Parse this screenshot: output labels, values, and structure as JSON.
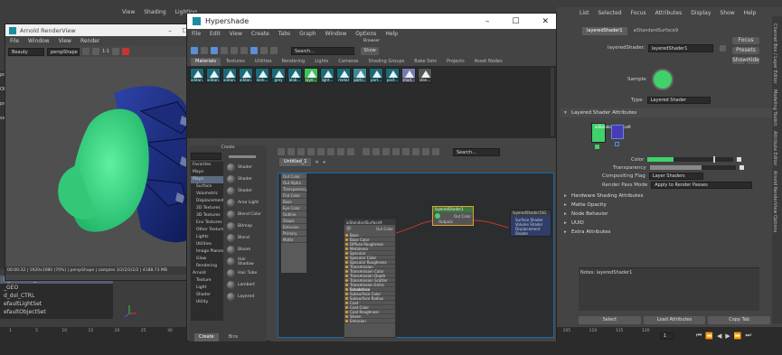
{
  "maya_main": {
    "menu_right": [
      "List",
      "Selected",
      "Focus",
      "Attributes",
      "Display",
      "Show",
      "Help"
    ],
    "left_labels": [
      "port",
      "Obj",
      "ps",
      "ss",
      "ssL",
      "sSL",
      "0",
      "GEO"
    ],
    "outliner_items": [
      "R_shoulder_GEO",
      "_GEO",
      "d_dol_CTRL",
      "efaultLightSet",
      "efaultObjectSet"
    ],
    "timeline_ticks": [
      "1",
      "5",
      "10",
      "15",
      "20",
      "25",
      "30",
      "35",
      "40",
      "45",
      "50",
      "55",
      "60",
      "65",
      "70",
      "75",
      "80",
      "85",
      "90",
      "95",
      "100",
      "105",
      "110",
      "115",
      "120"
    ],
    "frame_field": "1",
    "top_menu": [
      "View",
      "Shading",
      "Lighting"
    ]
  },
  "renderview": {
    "title": "Arnold RenderView",
    "menu": [
      "File",
      "Window",
      "View",
      "Render"
    ],
    "camera_preset": "Beauty",
    "camera": "perspShape",
    "ratio": "1:1",
    "status": "00:00:32 | 1920x1080 (70%) | perspShape | samples 3/2/2/2/2/2 | 4188.73 MB"
  },
  "hypershade": {
    "title": "Hypershade",
    "menu": [
      "File",
      "Edit",
      "View",
      "Create",
      "Tabs",
      "Graph",
      "Window",
      "Options",
      "Help"
    ],
    "browser_label": "Browser",
    "search_placeholder": "Search...",
    "show_label": "Show",
    "browser_tabs": [
      "Materials",
      "Textures",
      "Utilities",
      "Rendering",
      "Lights",
      "Cameras",
      "Shading Groups",
      "Bake Sets",
      "Projects",
      "Asset Nodes"
    ],
    "materials": [
      {
        "name": "aiStan...",
        "color": "#1a6b7a"
      },
      {
        "name": "aiStan...",
        "color": "#1a6b7a"
      },
      {
        "name": "aiStan...",
        "color": "#1a6b7a"
      },
      {
        "name": "aiStan...",
        "color": "#1a6b7a"
      },
      {
        "name": "dark...",
        "color": "#1a6b7a"
      },
      {
        "name": "grey",
        "color": "#1a6b7a"
      },
      {
        "name": "blob...",
        "color": "#1a6b7a"
      },
      {
        "name": "laye...",
        "color": "#3fc45a"
      },
      {
        "name": "light...",
        "color": "#1a6b7a"
      },
      {
        "name": "metal",
        "color": "#1a6b7a"
      },
      {
        "name": "parti...",
        "color": "#3a8a9a"
      },
      {
        "name": "part...",
        "color": "#1a6b7a"
      },
      {
        "name": "past...",
        "color": "#1a6b7a"
      },
      {
        "name": "shad...",
        "color": "#7a7ab0"
      },
      {
        "name": "stan...",
        "color": "#555555"
      }
    ],
    "create_label": "Create",
    "create_tree": [
      "Favorites",
      "Maya",
      "Maya",
      "Surface",
      "Volumetric",
      "Displacement",
      "2D Textures",
      "3D Textures",
      "Env Textures",
      "Other Textures",
      "Lights",
      "Utilities",
      "Image Planes",
      "Glow",
      "Rendering",
      "Arnold",
      "Texture",
      "Light",
      "Shader",
      "Utility"
    ],
    "create_nodes": [
      "Shader",
      "Shader",
      "Shader",
      "Area Light",
      "Blend Color",
      "Bitmap",
      "Blend",
      "Bloom",
      "Hair Shadow",
      "Hair Tube",
      "Lambert",
      "Layered"
    ],
    "bottom_tabs": [
      "Create",
      "Bins"
    ],
    "graph_tab": "Untitled_1",
    "graph_search_placeholder": "Search...",
    "left_panel_rows": [
      "Out Color",
      "Out Alpha",
      "Transparency",
      "Flat Color",
      "Base",
      "Eye Color",
      "Outline",
      "Shape",
      "Emission",
      "Primary",
      "Matte"
    ],
    "node_std": {
      "title": "aiStandardSurface9",
      "out_label": "Out Color",
      "rows": [
        "Base",
        "Base Color",
        "Diffuse Roughness",
        "Metalness",
        "Specular",
        "Specular Color",
        "Specular Roughness",
        "Transmission",
        "Transmission Color",
        "Transmission Depth",
        "Transmission Scatter",
        "Transmission Extra Roughness",
        "Subsurface",
        "Subsurface Color",
        "Subsurface Radius",
        "Coat",
        "Coat Color",
        "Coat Roughness",
        "Sheen",
        "Emission"
      ]
    },
    "node_layered": {
      "title": "layeredShader1",
      "out_label": "Out Color",
      "in_label": "Outputs"
    },
    "node_sg": {
      "title": "layeredShader1SG",
      "rows": [
        "Surface Shader",
        "Volume Shader",
        "Displacement Shader"
      ]
    }
  },
  "attr_editor": {
    "tabs": [
      "layeredShader1",
      "aiStandardSurface9"
    ],
    "shader_label": "layeredShader:",
    "shader_name": "layeredShader1",
    "focus_label": "Focus",
    "presets_label": "Presets",
    "show_label": "Show",
    "hide_label": "Hide",
    "sample_label": "Sample",
    "type_label": "Type",
    "type_value": "Layered Shader",
    "section_main": "Layered Shader Attributes",
    "layer_label": "aiStandardSurface9",
    "color_label": "Color",
    "color_fraction": 0.3,
    "transparency_label": "Transparency",
    "transparency_fraction": 0.6,
    "compositing_label": "Compositing Flag",
    "compositing_value": "Layer Shaders",
    "render_pass_label": "Render Pass Mode",
    "render_pass_value": "Apply to Render Passes",
    "sections": [
      "Hardware Shading Attributes",
      "Matte Opacity",
      "Node Behavior",
      "UUID",
      "Extra Attributes"
    ],
    "notes_label": "Notes: layeredShader1",
    "footer": [
      "Select",
      "Load Attributes",
      "Copy Tab"
    ],
    "side_tabs": [
      "Channel Box / Layer Editor",
      "Modeling Toolkit",
      "Attribute Editor",
      "Arnold RenderView Options"
    ]
  },
  "colors": {
    "accent_green": "#3fd16a",
    "maya_blue": "#5b8fd6",
    "window_bg": "#444444"
  }
}
